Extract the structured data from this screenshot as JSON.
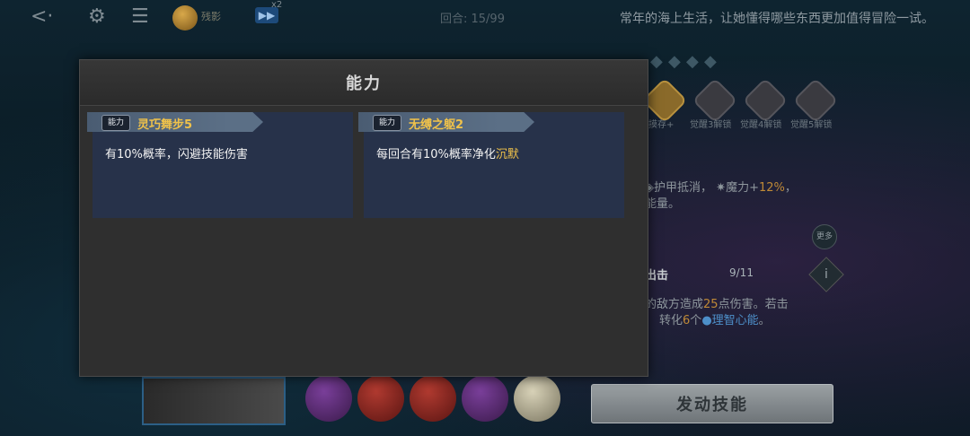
{
  "top_bar": {
    "coin_label": "残影",
    "speed_label": "▶▶",
    "speed_multiplier": "x2",
    "turn_counter": "回合: 15/99",
    "story_text": "常年的海上生活，让她懂得哪些东西更加值得冒险一试。"
  },
  "side_panel": {
    "unlock_labels": [
      "摸存+",
      "觉醒3解锁",
      "觉醒4解锁",
      "觉醒5解锁"
    ],
    "passive_line1_a": "护甲抵消，",
    "passive_line1_b": "魔力+",
    "passive_line1_c": "12%",
    "passive_line1_d": "，",
    "passive_line2": "能量。",
    "more_label": "更多",
    "skill_name_partial": "出击",
    "progress": "9/11",
    "skill_desc_line1_a": "的敌方造成",
    "skill_desc_line1_b": "25",
    "skill_desc_line1_c": "点伤害。若击",
    "skill_desc_line2_a": "转化",
    "skill_desc_line2_b": "6",
    "skill_desc_line2_c": "个",
    "skill_desc_line2_d": "理智心能",
    "skill_desc_line2_e": "。"
  },
  "action_button": "发动技能",
  "modal": {
    "title": "能力",
    "abilities": [
      {
        "tag": "能力",
        "name": "灵巧舞步5",
        "desc_before": "有10%概率，闪避技能伤害",
        "desc_highlight": "",
        "desc_after": ""
      },
      {
        "tag": "能力",
        "name": "无缚之躯2",
        "desc_before": "每回合有10%概率净化",
        "desc_highlight": "沉默",
        "desc_after": ""
      }
    ]
  },
  "colors": {
    "highlight": "#f0c24a",
    "card_bg": "#27324a",
    "modal_bg": "#2f2f2f"
  }
}
